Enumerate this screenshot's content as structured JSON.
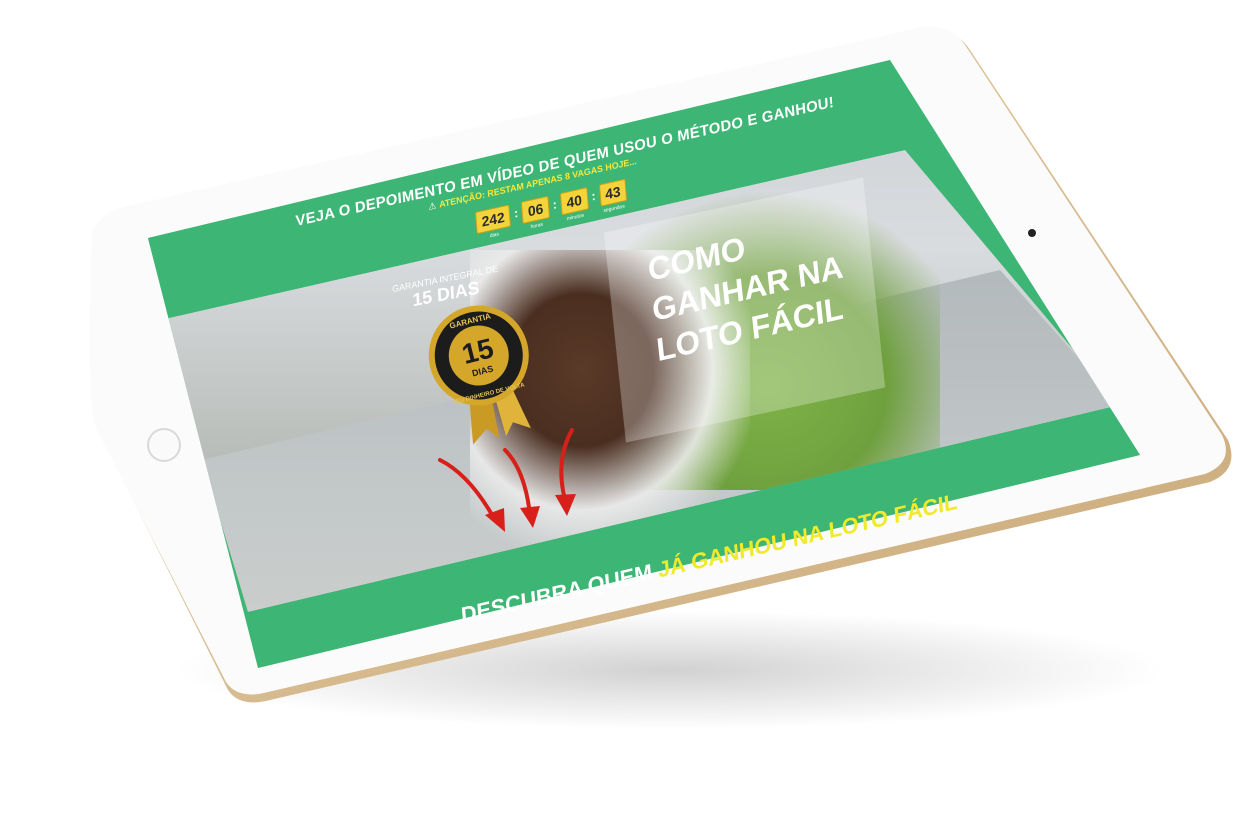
{
  "header": {
    "headline": "VEJA O DEPOIMENTO EM VÍDEO DE QUEM USOU O MÉTODO E GANHOU!",
    "attention": "ATENÇÃO: RESTAM APENAS 8 VAGAS HOJE..."
  },
  "countdown": {
    "days": "242",
    "hours": "06",
    "minutes": "40",
    "seconds": "43",
    "days_label": "dias",
    "hours_label": "horas",
    "minutes_label": "minutos",
    "seconds_label": "segundos"
  },
  "guarantee": {
    "label_small": "GARANTIA INTEGRAL DE",
    "label_big": "15 DIAS",
    "seal_top": "GARANTIA",
    "seal_number": "15",
    "seal_unit": "DIAS",
    "seal_ring": "SEU DINHEIRO DE VOLTA"
  },
  "hero": {
    "title": "COMO GANHAR NA LOTO FÁCIL"
  },
  "cta": {
    "prefix": "DESCUBRA QUEM",
    "highlight": "JÁ GANHOU NA LOTO FÁCIL"
  },
  "colors": {
    "brand_green": "#3db574",
    "accent_yellow": "#f0ea2c",
    "countdown_yellow": "#f4d43a",
    "seal_gold": "#d4a62a",
    "arrow_red": "#d7201a"
  },
  "icons": {
    "warning": "warning-icon",
    "arrow": "arrow-down-icon",
    "home": "home-button-icon",
    "camera": "camera-icon"
  }
}
